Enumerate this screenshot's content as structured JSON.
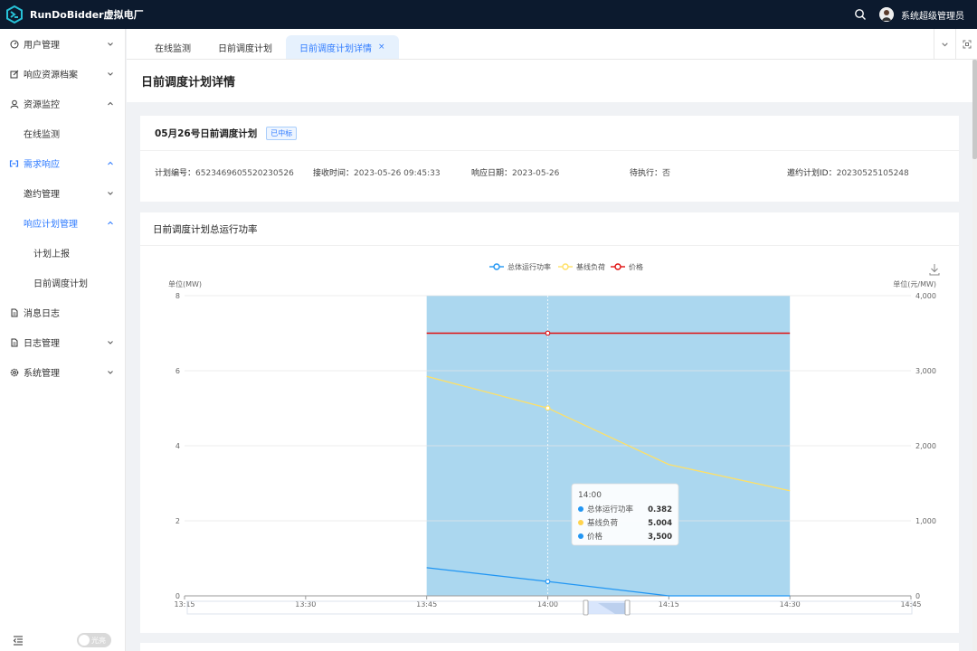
{
  "app": {
    "title": "RunDoBidder虚拟电厂"
  },
  "header": {
    "user_name": "系统超级管理员"
  },
  "sidebar": {
    "items": [
      {
        "label": "用户管理",
        "icon": "dashboard-icon",
        "level": 1,
        "expanded": false
      },
      {
        "label": "响应资源档案",
        "icon": "edit-icon",
        "level": 1,
        "expanded": false
      },
      {
        "label": "资源监控",
        "icon": "user-icon",
        "level": 1,
        "expanded": true
      },
      {
        "label": "在线监测",
        "level": 2
      },
      {
        "label": "需求响应",
        "icon": "link-icon",
        "level": 1,
        "expanded": true,
        "active": true
      },
      {
        "label": "邀约管理",
        "level": 2,
        "expanded": false
      },
      {
        "label": "响应计划管理",
        "level": 2,
        "expanded": true,
        "active": true
      },
      {
        "label": "计划上报",
        "level": 3
      },
      {
        "label": "日前调度计划",
        "level": 3
      },
      {
        "label": "消息日志",
        "icon": "file-icon",
        "level": 1
      },
      {
        "label": "日志管理",
        "icon": "file-icon",
        "level": 1,
        "expanded": false
      },
      {
        "label": "系统管理",
        "icon": "gear-icon",
        "level": 1,
        "expanded": false
      }
    ],
    "theme_toggle_label": "光亮"
  },
  "tabs": [
    {
      "label": "在线监测"
    },
    {
      "label": "日前调度计划"
    },
    {
      "label": "日前调度计划详情",
      "active": true,
      "close": "×"
    }
  ],
  "page": {
    "title": "日前调度计划详情"
  },
  "plan": {
    "title": "05月26号日前调度计划",
    "status": "已中标",
    "fields": [
      {
        "label": "计划编号：",
        "value": "6523469605520230526"
      },
      {
        "label": "接收时间：",
        "value": "2023-05-26 09:45:33"
      },
      {
        "label": "响应日期：",
        "value": "2023-05-26"
      },
      {
        "label": "待执行：",
        "value": "否"
      },
      {
        "label": "邀约计划ID：",
        "value": "20230525105248"
      }
    ]
  },
  "chart_section": {
    "title": "日前调度计划总运行功率"
  },
  "chart_data": {
    "type": "line",
    "x": [
      "13:15",
      "13:30",
      "13:45",
      "14:00",
      "14:15",
      "14:30",
      "14:45"
    ],
    "series": [
      {
        "name": "总体运行功率",
        "color": "#2196f3",
        "axis": "left",
        "marker": "circle",
        "values": [
          null,
          null,
          0.75,
          0.382,
          0,
          0,
          null
        ]
      },
      {
        "name": "基线负荷",
        "color": "#ffe066",
        "axis": "left",
        "marker": "circle",
        "values": [
          null,
          null,
          5.85,
          5.004,
          3.5,
          2.8,
          null
        ]
      },
      {
        "name": "价格",
        "color": "#e01010",
        "axis": "right",
        "marker": "circle",
        "values": [
          null,
          null,
          3500,
          3500,
          3500,
          3500,
          null
        ]
      }
    ],
    "y_left": {
      "label": "单位(MW)",
      "ticks": [
        "0",
        "2",
        "4",
        "6",
        "8"
      ],
      "range": [
        0,
        8
      ]
    },
    "y_right": {
      "label": "单位(元/MW)",
      "ticks": [
        "0",
        "1,000",
        "2,000",
        "3,000",
        "4,000"
      ],
      "range": [
        0,
        4000
      ]
    },
    "highlight_range": [
      "13:45",
      "14:30"
    ],
    "highlight_color": "#abd7ef",
    "legend_position": "top-center",
    "grid": true,
    "tooltip": {
      "title": "14:00",
      "rows": [
        {
          "name": "总体运行功率",
          "value": "0.382",
          "color": "#2196f3"
        },
        {
          "name": "基线负荷",
          "value": "5.004",
          "color": "#ffd34d"
        },
        {
          "name": "价格",
          "value": "3,500",
          "color": "#2196f3"
        }
      ]
    }
  },
  "colors": {
    "accent": "#2f7bff",
    "topbar": "#0c1a2e"
  }
}
